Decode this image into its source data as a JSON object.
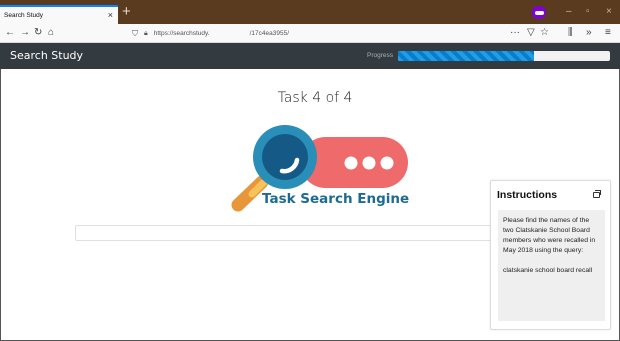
{
  "browser": {
    "tab_title": "Search Study",
    "tab_close": "×",
    "new_tab": "+",
    "url_domain": "https://searchstudy.",
    "url_path": "/17c4ea3955/",
    "window_controls": {
      "minimize": "–",
      "maximize": "▫",
      "close": "×"
    },
    "toolbar_icons": {
      "back": "←",
      "forward": "→",
      "reload": "↻",
      "home": "⌂",
      "more": "···",
      "pocket": "▽",
      "bookmark": "☆",
      "library": "⫼",
      "overflow": "»",
      "menu": "≡"
    }
  },
  "app": {
    "brand": "Search Study",
    "progress_label": "Progress",
    "progress_fraction": 0.64
  },
  "main": {
    "task_title": "Task 4 of 4",
    "logo_text": "Task Search Engine",
    "search_value": ""
  },
  "instructions": {
    "title": "Instructions",
    "text": "Please find the names of the two Clatskanie School Board members who were recalled in May 2018 using the query:",
    "query": "clatskanie school board recall"
  },
  "colors": {
    "brand_blue": "#1d6b92",
    "pill_red": "#ef6a6a",
    "handle_orange": "#f2a23a",
    "progress_blue": "#1e9fe0",
    "header_dark": "#333a40"
  }
}
